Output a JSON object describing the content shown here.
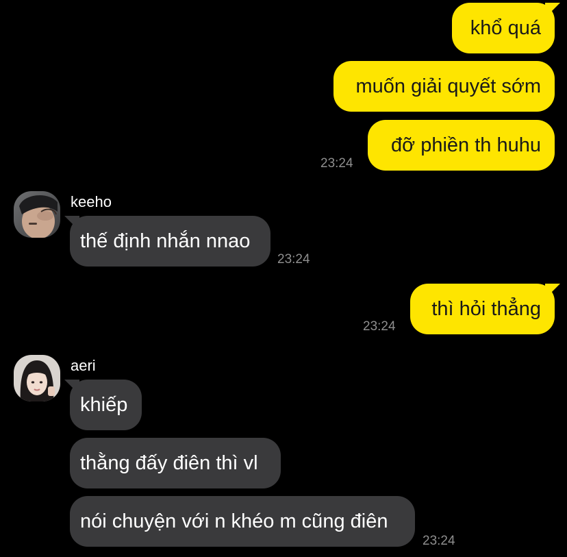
{
  "conversation": {
    "outgoing_group_1": {
      "messages": [
        "khổ quá",
        "muốn giải quyết sớm",
        "đỡ phiền th huhu"
      ],
      "time": "23:24"
    },
    "incoming_group_1": {
      "sender": "keeho",
      "avatar_icon": "person-photo-avatar",
      "messages": [
        "thế định nhắn nnao"
      ],
      "time": "23:24"
    },
    "outgoing_group_2": {
      "messages": [
        "thì hỏi thẳng"
      ],
      "time": "23:24"
    },
    "incoming_group_2": {
      "sender": "aeri",
      "avatar_icon": "person-photo-avatar",
      "messages": [
        "khiếp",
        "thằng đấy điên thì vl",
        "nói chuyện với n khéo m cũng điên"
      ],
      "time": "23:24"
    }
  },
  "colors": {
    "background": "#000000",
    "outgoing_bubble": "#fee500",
    "incoming_bubble": "#3a3a3c",
    "timestamp": "#8e8e8e"
  }
}
